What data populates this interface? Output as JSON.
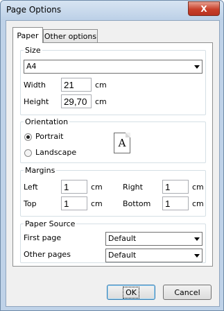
{
  "window": {
    "title": "Page Options",
    "close_label": "X"
  },
  "tabs": [
    {
      "label": "Paper"
    },
    {
      "label": "Other options"
    }
  ],
  "size": {
    "legend": "Size",
    "paper_value": "A4",
    "width_label": "Width",
    "width_value": "21",
    "height_label": "Height",
    "height_value": "29,70",
    "unit": "cm"
  },
  "orientation": {
    "legend": "Orientation",
    "portrait_label": "Portrait",
    "landscape_label": "Landscape",
    "selected": "Portrait",
    "preview_letter": "A"
  },
  "margins": {
    "legend": "Margins",
    "left_label": "Left",
    "left_value": "1",
    "right_label": "Right",
    "right_value": "1",
    "top_label": "Top",
    "top_value": "1",
    "bottom_label": "Bottom",
    "bottom_value": "1",
    "unit": "cm"
  },
  "paper_source": {
    "legend": "Paper Source",
    "first_page_label": "First page",
    "first_page_value": "Default",
    "other_pages_label": "Other pages",
    "other_pages_value": "Default"
  },
  "buttons": {
    "ok": "OK",
    "cancel": "Cancel"
  }
}
